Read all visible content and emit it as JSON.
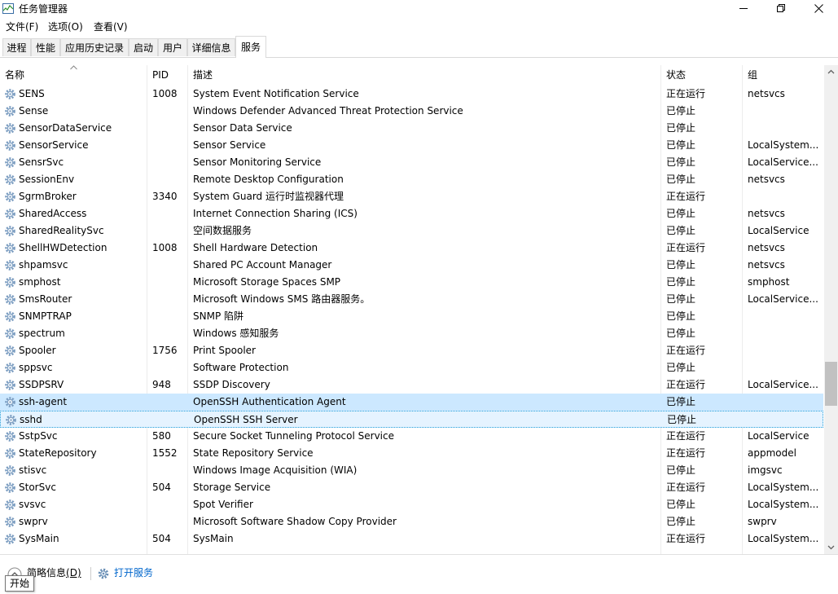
{
  "window": {
    "title": "任务管理器"
  },
  "menu": {
    "file": "文件(F)",
    "options": "选项(O)",
    "view": "查看(V)"
  },
  "tabs": [
    {
      "label": "进程"
    },
    {
      "label": "性能"
    },
    {
      "label": "应用历史记录"
    },
    {
      "label": "启动"
    },
    {
      "label": "用户"
    },
    {
      "label": "详细信息"
    },
    {
      "label": "服务"
    }
  ],
  "active_tab": "服务",
  "columns": {
    "name": "名称",
    "pid": "PID",
    "desc": "描述",
    "status": "状态",
    "group": "组"
  },
  "services": [
    {
      "name": "SENS",
      "pid": "1008",
      "desc": "System Event Notification Service",
      "status": "正在运行",
      "group": "netsvcs"
    },
    {
      "name": "Sense",
      "pid": "",
      "desc": "Windows Defender Advanced Threat Protection Service",
      "status": "已停止",
      "group": ""
    },
    {
      "name": "SensorDataService",
      "pid": "",
      "desc": "Sensor Data Service",
      "status": "已停止",
      "group": ""
    },
    {
      "name": "SensorService",
      "pid": "",
      "desc": "Sensor Service",
      "status": "已停止",
      "group": "LocalSystem..."
    },
    {
      "name": "SensrSvc",
      "pid": "",
      "desc": "Sensor Monitoring Service",
      "status": "已停止",
      "group": "LocalService..."
    },
    {
      "name": "SessionEnv",
      "pid": "",
      "desc": "Remote Desktop Configuration",
      "status": "已停止",
      "group": "netsvcs"
    },
    {
      "name": "SgrmBroker",
      "pid": "3340",
      "desc": "System Guard 运行时监视器代理",
      "status": "正在运行",
      "group": ""
    },
    {
      "name": "SharedAccess",
      "pid": "",
      "desc": "Internet Connection Sharing (ICS)",
      "status": "已停止",
      "group": "netsvcs"
    },
    {
      "name": "SharedRealitySvc",
      "pid": "",
      "desc": "空间数据服务",
      "status": "已停止",
      "group": "LocalService"
    },
    {
      "name": "ShellHWDetection",
      "pid": "1008",
      "desc": "Shell Hardware Detection",
      "status": "正在运行",
      "group": "netsvcs"
    },
    {
      "name": "shpamsvc",
      "pid": "",
      "desc": "Shared PC Account Manager",
      "status": "已停止",
      "group": "netsvcs"
    },
    {
      "name": "smphost",
      "pid": "",
      "desc": "Microsoft Storage Spaces SMP",
      "status": "已停止",
      "group": "smphost"
    },
    {
      "name": "SmsRouter",
      "pid": "",
      "desc": "Microsoft Windows SMS 路由器服务。",
      "status": "已停止",
      "group": "LocalService..."
    },
    {
      "name": "SNMPTRAP",
      "pid": "",
      "desc": "SNMP 陷阱",
      "status": "已停止",
      "group": ""
    },
    {
      "name": "spectrum",
      "pid": "",
      "desc": "Windows 感知服务",
      "status": "已停止",
      "group": ""
    },
    {
      "name": "Spooler",
      "pid": "1756",
      "desc": "Print Spooler",
      "status": "正在运行",
      "group": ""
    },
    {
      "name": "sppsvc",
      "pid": "",
      "desc": "Software Protection",
      "status": "已停止",
      "group": ""
    },
    {
      "name": "SSDPSRV",
      "pid": "948",
      "desc": "SSDP Discovery",
      "status": "正在运行",
      "group": "LocalService..."
    },
    {
      "name": "ssh-agent",
      "pid": "",
      "desc": "OpenSSH Authentication Agent",
      "status": "已停止",
      "group": "",
      "state": "sel"
    },
    {
      "name": "sshd",
      "pid": "",
      "desc": "OpenSSH SSH Server",
      "status": "已停止",
      "group": "",
      "state": "focus"
    },
    {
      "name": "SstpSvc",
      "pid": "580",
      "desc": "Secure Socket Tunneling Protocol Service",
      "status": "正在运行",
      "group": "LocalService"
    },
    {
      "name": "StateRepository",
      "pid": "1552",
      "desc": "State Repository Service",
      "status": "正在运行",
      "group": "appmodel"
    },
    {
      "name": "stisvc",
      "pid": "",
      "desc": "Windows Image Acquisition (WIA)",
      "status": "已停止",
      "group": "imgsvc"
    },
    {
      "name": "StorSvc",
      "pid": "504",
      "desc": "Storage Service",
      "status": "正在运行",
      "group": "LocalSystem..."
    },
    {
      "name": "svsvc",
      "pid": "",
      "desc": "Spot Verifier",
      "status": "已停止",
      "group": "LocalSystem..."
    },
    {
      "name": "swprv",
      "pid": "",
      "desc": "Microsoft Software Shadow Copy Provider",
      "status": "已停止",
      "group": "swprv"
    },
    {
      "name": "SysMain",
      "pid": "504",
      "desc": "SysMain",
      "status": "正在运行",
      "group": "LocalSystem..."
    }
  ],
  "footer": {
    "fewer_details": "简略信息",
    "fewer_details_key": "(D)",
    "open_services": "打开服务",
    "tooltip": "开始"
  },
  "colors": {
    "selected_row": "#cce8ff",
    "focused_row": "#e5f3ff",
    "link": "#0066cc"
  }
}
